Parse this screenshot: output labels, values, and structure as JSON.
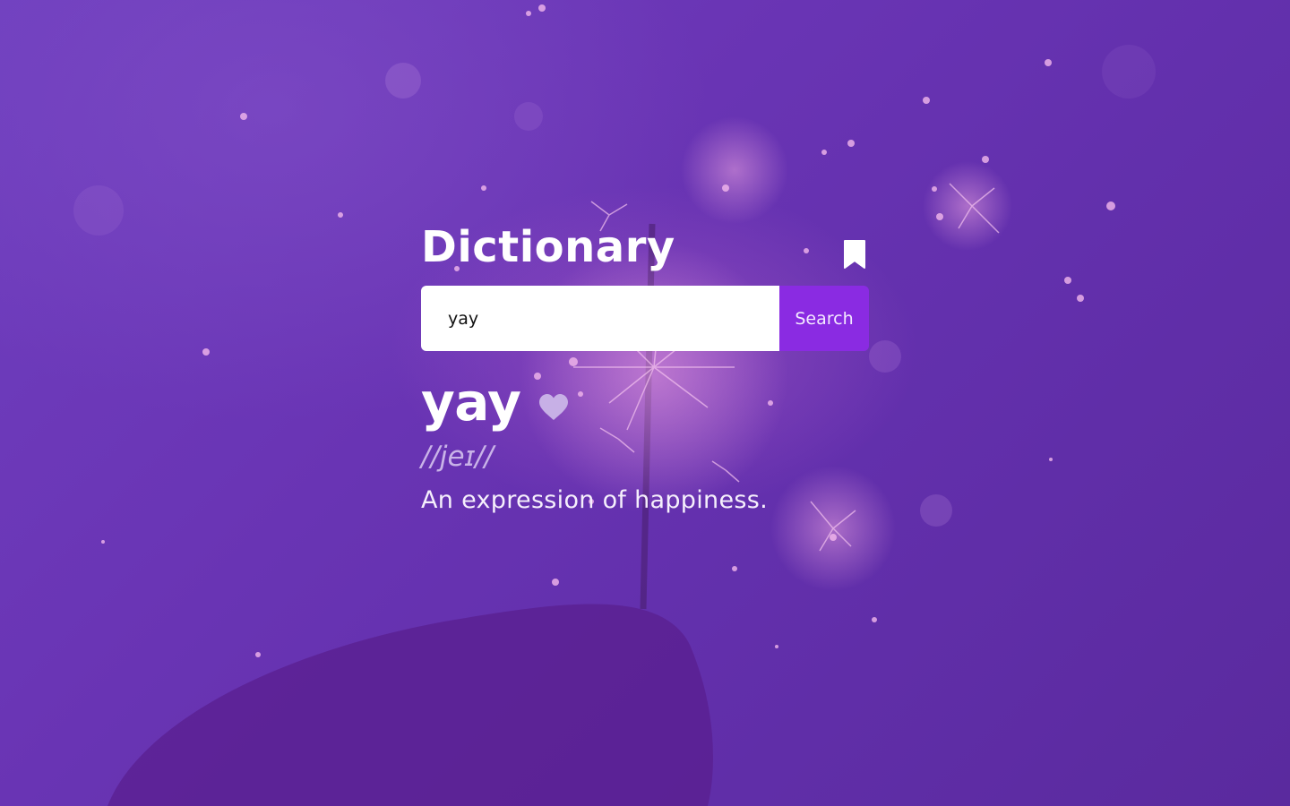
{
  "app": {
    "title": "Dictionary"
  },
  "header": {
    "bookmark_icon": "bookmark-icon"
  },
  "search": {
    "value": "yay",
    "button_label": "Search"
  },
  "result": {
    "word": "yay",
    "favorite_icon": "heart-icon",
    "phonetic": "//jeɪ//",
    "definition": "An expression of happiness."
  },
  "colors": {
    "background": "#6a35b5",
    "accent": "#8a2be2",
    "phonetic_text": "#c9b3e8",
    "heart": "#c7b0e6"
  }
}
